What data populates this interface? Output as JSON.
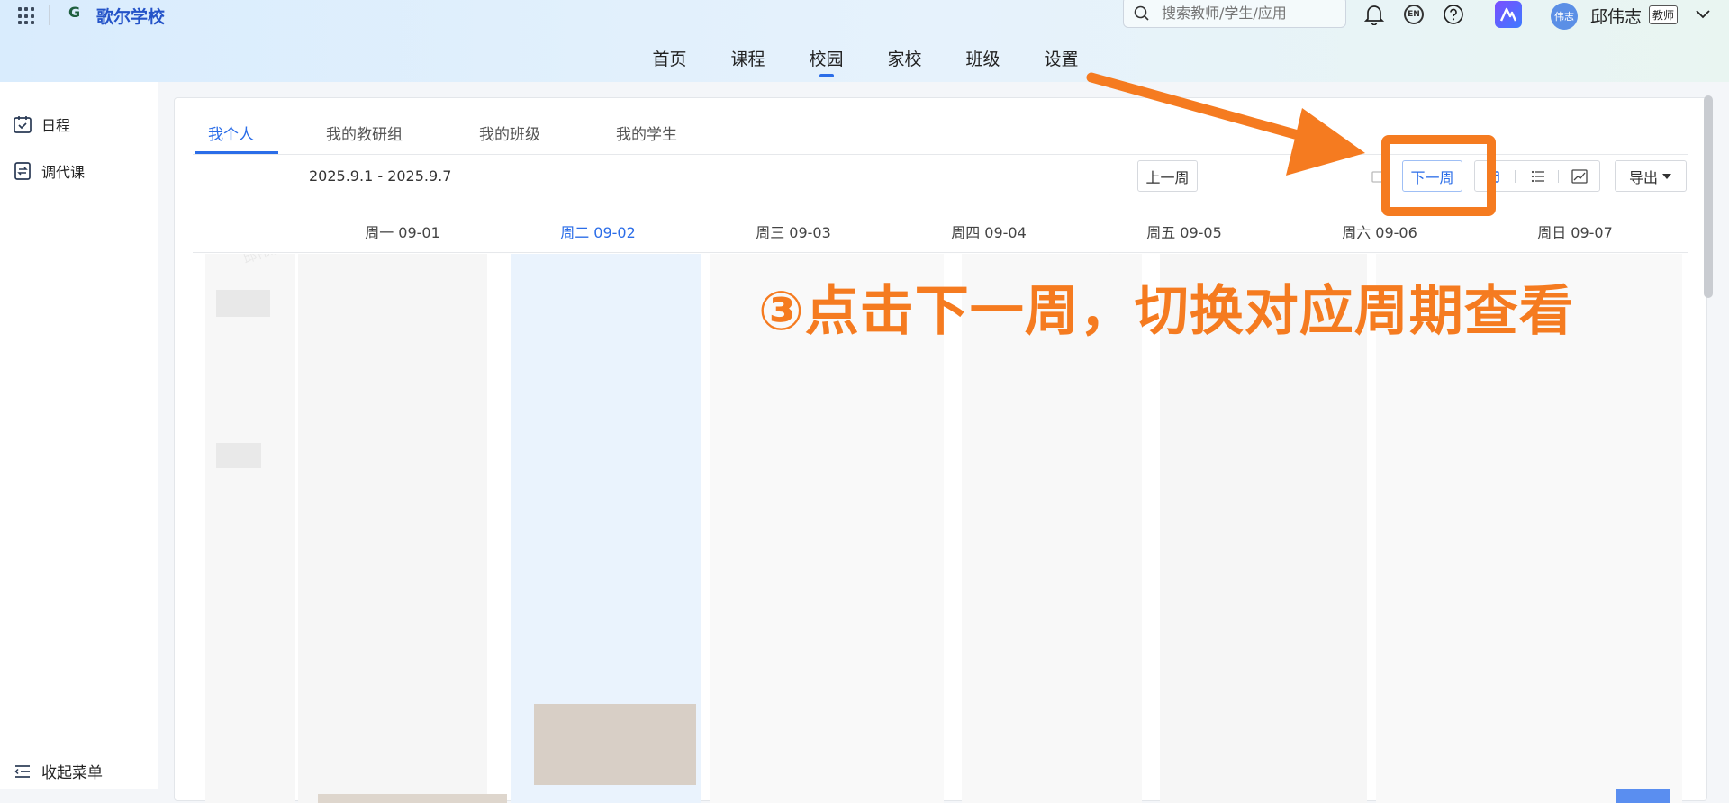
{
  "header": {
    "school_name": "歌尔学校",
    "logo_letter": "G",
    "search_placeholder": "搜索教师/学生/应用",
    "lang_badge": "EN",
    "user_name": "邱伟志",
    "avatar_text": "伟志",
    "role_badge": "教师"
  },
  "nav": [
    "首页",
    "课程",
    "校园",
    "家校",
    "班级",
    "设置"
  ],
  "nav_active": "校园",
  "sidebar": {
    "items": [
      {
        "label": "日程",
        "icon": "calendar-check-icon"
      },
      {
        "label": "调代课",
        "icon": "swap-doc-icon"
      }
    ],
    "collapse_label": "收起菜单"
  },
  "tabs": [
    "我个人",
    "我的教研组",
    "我的班级",
    "我的学生"
  ],
  "toolbar": {
    "prev_week": "上一周",
    "date_range": "2025.9.1 - 2025.9.7",
    "next_week": "下一周",
    "export": "导出"
  },
  "days": [
    {
      "label": "周一 09-01",
      "today": false
    },
    {
      "label": "周二 09-02",
      "today": true
    },
    {
      "label": "周三 09-03",
      "today": false
    },
    {
      "label": "周四 09-04",
      "today": false
    },
    {
      "label": "周五 09-05",
      "today": false
    },
    {
      "label": "周六 09-06",
      "today": false
    },
    {
      "label": "周日 09-07",
      "today": false
    }
  ],
  "watermark": "邱伟志-邱伟志",
  "annotation": "③点击下一周，切换对应周期查看",
  "colors": {
    "accent": "#2b6de8",
    "annotation": "#f57b20"
  }
}
